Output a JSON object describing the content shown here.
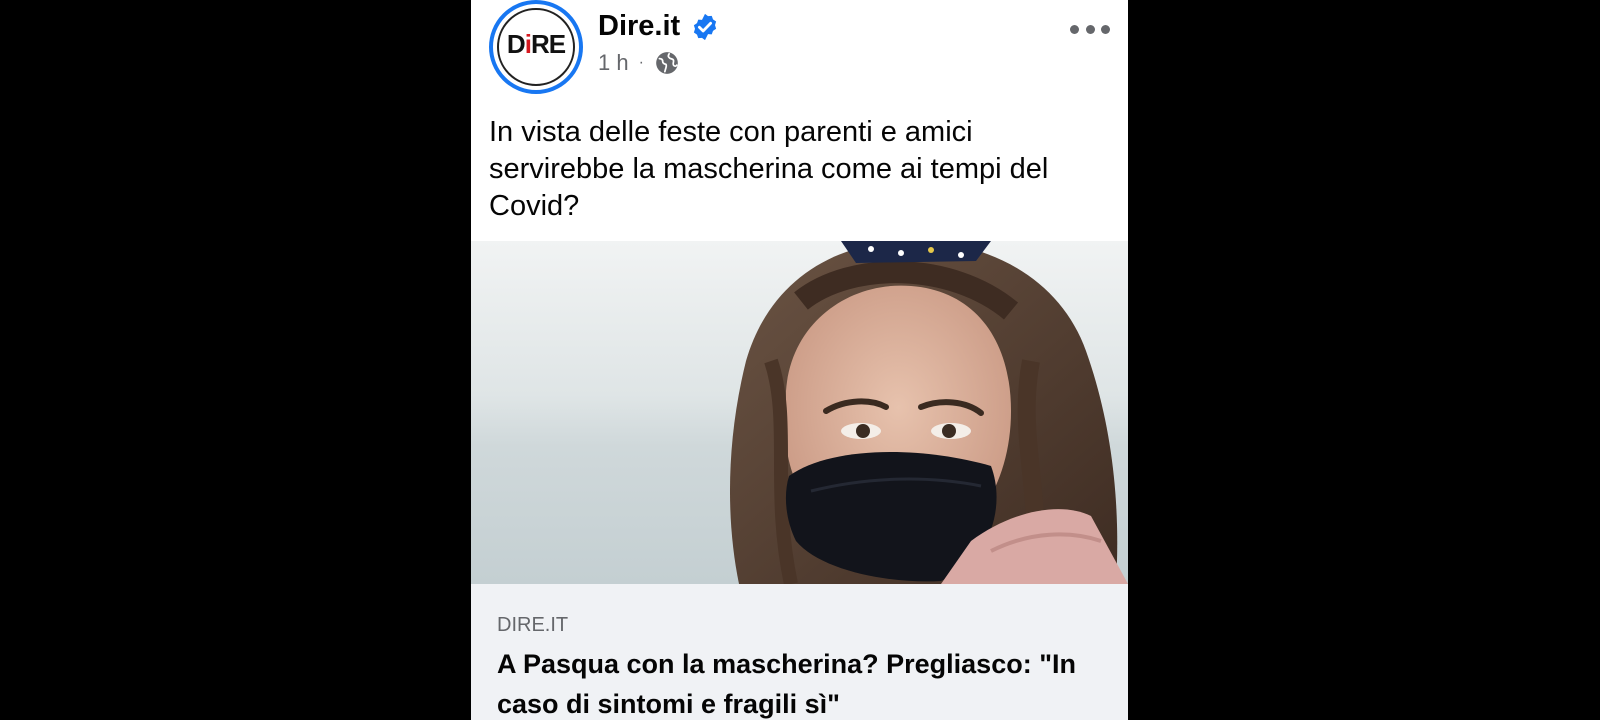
{
  "post": {
    "page_name": "Dire.it",
    "timestamp": "1 h",
    "separator": "·",
    "audience_icon": "globe-icon",
    "verified_icon": "verified-badge-icon",
    "more_icon": "more-options-icon",
    "logo_text": "DiRE",
    "caption": "In vista delle feste con parenti e amici servirebbe la mascherina come ai tempi del Covid?",
    "link": {
      "domain": "DIRE.IT",
      "headline": "A Pasqua con la mascherina? Pregliasco: \"In caso di sintomi e fragili sì\""
    }
  },
  "colors": {
    "accent": "#1877f2",
    "background": "#000000",
    "card": "#ffffff",
    "link_box": "#f0f2f5",
    "secondary_text": "#65676b"
  }
}
